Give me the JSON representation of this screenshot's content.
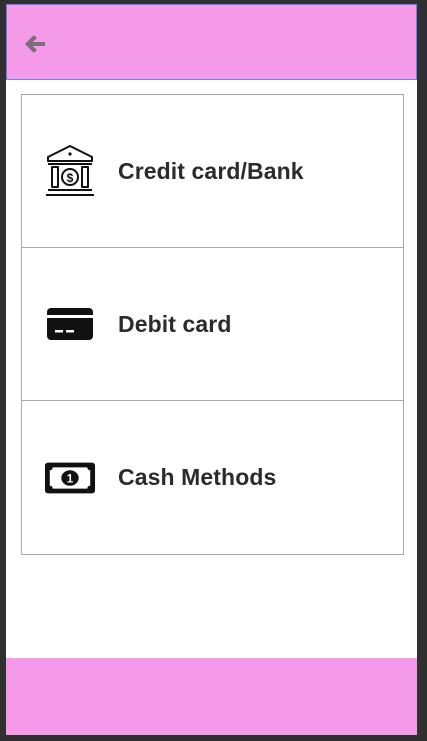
{
  "header": {
    "back_icon": "arrow-left-icon",
    "color": "#f59ae8"
  },
  "payment_methods": [
    {
      "label": "Credit card/Bank",
      "icon": "bank-icon"
    },
    {
      "label": "Debit card",
      "icon": "credit-card-icon"
    },
    {
      "label": "Cash Methods",
      "icon": "cash-note-icon"
    }
  ],
  "footer": {
    "color": "#f59ae8"
  }
}
